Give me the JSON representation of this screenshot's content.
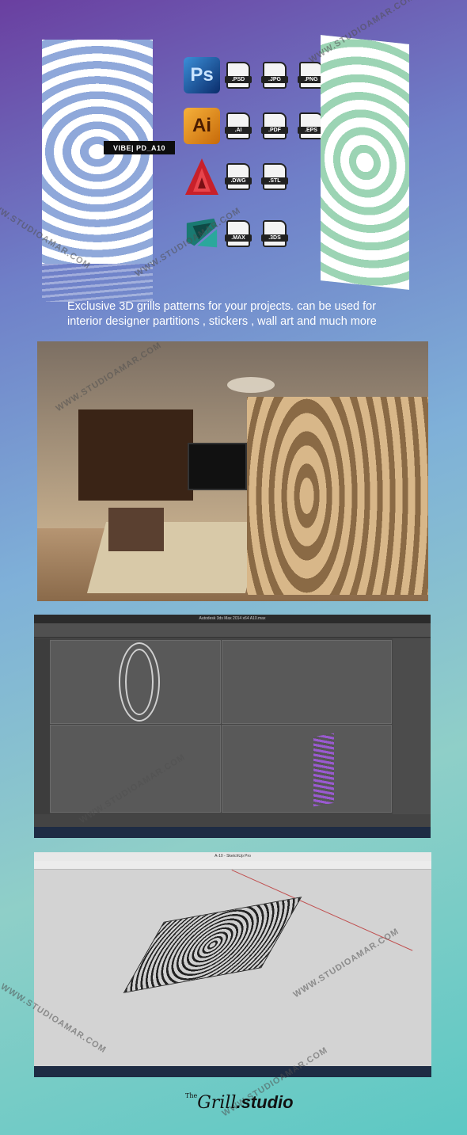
{
  "product": {
    "code": "VIBE|  PD_A10"
  },
  "software": [
    {
      "icon": "photoshop-icon",
      "name": "Ps",
      "formats": [
        ".PSD",
        ".JPG",
        ".PNG"
      ]
    },
    {
      "icon": "illustrator-icon",
      "name": "Ai",
      "formats": [
        ".AI",
        ".PDF",
        ".EPS"
      ]
    },
    {
      "icon": "autocad-icon",
      "name": "",
      "formats": [
        ".DWG",
        ".STL"
      ]
    },
    {
      "icon": "3dsmax-icon",
      "name": "",
      "formats": [
        ".MAX",
        ".3DS"
      ]
    }
  ],
  "caption": {
    "line1": "Exclusive  3D grills patterns for your projects.  can be used for",
    "line2": "interior designer partitions , stickers , wall art and much more"
  },
  "max_window": {
    "title": "Autodesk 3ds Max 2014 x64    A10.max"
  },
  "sketchup_window": {
    "title": "A-10 - SketchUp Pro"
  },
  "watermark": "WWW.STUDIOAMAR.COM",
  "logo": {
    "the": "The",
    "grill": "Grill",
    "studio": "studio"
  },
  "colors": {
    "accent": "#5cc8c4",
    "purple": "#6a3fa0"
  }
}
